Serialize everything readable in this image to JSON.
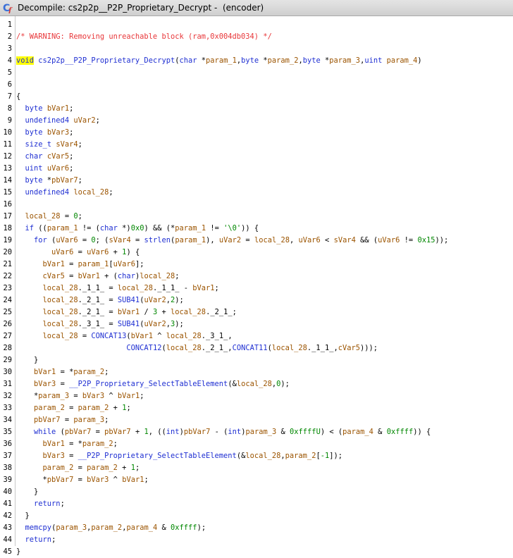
{
  "window": {
    "title": "Decompile: cs2p2p__P2P_Proprietary_Decrypt -  (encoder)",
    "icon": "decompiler-cf-icon"
  },
  "colors": {
    "comment": "#e8373a",
    "type": "#1f2fd2",
    "function": "#1f2fd2",
    "variable": "#9b5400",
    "number": "#008700",
    "highlight": "#ffff00"
  },
  "code_lines": [
    {
      "n": "1",
      "tokens": []
    },
    {
      "n": "2",
      "tokens": [
        [
          "cm",
          "/* WARNING: Removing unreachable block (ram,0x004db034) */"
        ]
      ]
    },
    {
      "n": "3",
      "tokens": []
    },
    {
      "n": "4",
      "tokens": [
        [
          "hl",
          "void"
        ],
        [
          "pl",
          " "
        ],
        [
          "fn",
          "cs2p2p__P2P_Proprietary_Decrypt"
        ],
        [
          "pl",
          "("
        ],
        [
          "ty",
          "char"
        ],
        [
          "pl",
          " *"
        ],
        [
          "vr",
          "param_1"
        ],
        [
          "pl",
          ","
        ],
        [
          "ty",
          "byte"
        ],
        [
          "pl",
          " *"
        ],
        [
          "vr",
          "param_2"
        ],
        [
          "pl",
          ","
        ],
        [
          "ty",
          "byte"
        ],
        [
          "pl",
          " *"
        ],
        [
          "vr",
          "param_3"
        ],
        [
          "pl",
          ","
        ],
        [
          "ty",
          "uint"
        ],
        [
          "pl",
          " "
        ],
        [
          "vr",
          "param_4"
        ],
        [
          "pl",
          ")"
        ]
      ]
    },
    {
      "n": "5",
      "tokens": []
    },
    {
      "n": "6",
      "tokens": []
    },
    {
      "n": "7",
      "tokens": [
        [
          "pl",
          "{"
        ]
      ]
    },
    {
      "n": "8",
      "tokens": [
        [
          "pl",
          "  "
        ],
        [
          "ty",
          "byte"
        ],
        [
          "pl",
          " "
        ],
        [
          "vr",
          "bVar1"
        ],
        [
          "pl",
          ";"
        ]
      ]
    },
    {
      "n": "9",
      "tokens": [
        [
          "pl",
          "  "
        ],
        [
          "ty",
          "undefined4"
        ],
        [
          "pl",
          " "
        ],
        [
          "vr",
          "uVar2"
        ],
        [
          "pl",
          ";"
        ]
      ]
    },
    {
      "n": "10",
      "tokens": [
        [
          "pl",
          "  "
        ],
        [
          "ty",
          "byte"
        ],
        [
          "pl",
          " "
        ],
        [
          "vr",
          "bVar3"
        ],
        [
          "pl",
          ";"
        ]
      ]
    },
    {
      "n": "11",
      "tokens": [
        [
          "pl",
          "  "
        ],
        [
          "ty",
          "size_t"
        ],
        [
          "pl",
          " "
        ],
        [
          "vr",
          "sVar4"
        ],
        [
          "pl",
          ";"
        ]
      ]
    },
    {
      "n": "12",
      "tokens": [
        [
          "pl",
          "  "
        ],
        [
          "ty",
          "char"
        ],
        [
          "pl",
          " "
        ],
        [
          "vr",
          "cVar5"
        ],
        [
          "pl",
          ";"
        ]
      ]
    },
    {
      "n": "13",
      "tokens": [
        [
          "pl",
          "  "
        ],
        [
          "ty",
          "uint"
        ],
        [
          "pl",
          " "
        ],
        [
          "vr",
          "uVar6"
        ],
        [
          "pl",
          ";"
        ]
      ]
    },
    {
      "n": "14",
      "tokens": [
        [
          "pl",
          "  "
        ],
        [
          "ty",
          "byte"
        ],
        [
          "pl",
          " *"
        ],
        [
          "vr",
          "pbVar7"
        ],
        [
          "pl",
          ";"
        ]
      ]
    },
    {
      "n": "15",
      "tokens": [
        [
          "pl",
          "  "
        ],
        [
          "ty",
          "undefined4"
        ],
        [
          "pl",
          " "
        ],
        [
          "vr",
          "local_28"
        ],
        [
          "pl",
          ";"
        ]
      ]
    },
    {
      "n": "16",
      "tokens": []
    },
    {
      "n": "17",
      "tokens": [
        [
          "pl",
          "  "
        ],
        [
          "vr",
          "local_28"
        ],
        [
          "pl",
          " = "
        ],
        [
          "nm",
          "0"
        ],
        [
          "pl",
          ";"
        ]
      ]
    },
    {
      "n": "18",
      "tokens": [
        [
          "pl",
          "  "
        ],
        [
          "kw",
          "if"
        ],
        [
          "pl",
          " (("
        ],
        [
          "vr",
          "param_1"
        ],
        [
          "pl",
          " != ("
        ],
        [
          "ty",
          "char"
        ],
        [
          "pl",
          " *)"
        ],
        [
          "nm",
          "0x0"
        ],
        [
          "pl",
          ") && (*"
        ],
        [
          "vr",
          "param_1"
        ],
        [
          "pl",
          " != "
        ],
        [
          "nm",
          "'\\0'"
        ],
        [
          "pl",
          ")) {"
        ]
      ]
    },
    {
      "n": "19",
      "tokens": [
        [
          "pl",
          "    "
        ],
        [
          "kw",
          "for"
        ],
        [
          "pl",
          " ("
        ],
        [
          "vr",
          "uVar6"
        ],
        [
          "pl",
          " = "
        ],
        [
          "nm",
          "0"
        ],
        [
          "pl",
          "; ("
        ],
        [
          "vr",
          "sVar4"
        ],
        [
          "pl",
          " = "
        ],
        [
          "fn",
          "strlen"
        ],
        [
          "pl",
          "("
        ],
        [
          "vr",
          "param_1"
        ],
        [
          "pl",
          "), "
        ],
        [
          "vr",
          "uVar2"
        ],
        [
          "pl",
          " = "
        ],
        [
          "vr",
          "local_28"
        ],
        [
          "pl",
          ", "
        ],
        [
          "vr",
          "uVar6"
        ],
        [
          "pl",
          " < "
        ],
        [
          "vr",
          "sVar4"
        ],
        [
          "pl",
          " && ("
        ],
        [
          "vr",
          "uVar6"
        ],
        [
          "pl",
          " != "
        ],
        [
          "nm",
          "0x15"
        ],
        [
          "pl",
          "));"
        ]
      ]
    },
    {
      "n": "20",
      "tokens": [
        [
          "pl",
          "        "
        ],
        [
          "vr",
          "uVar6"
        ],
        [
          "pl",
          " = "
        ],
        [
          "vr",
          "uVar6"
        ],
        [
          "pl",
          " + "
        ],
        [
          "nm",
          "1"
        ],
        [
          "pl",
          ") {"
        ]
      ]
    },
    {
      "n": "21",
      "tokens": [
        [
          "pl",
          "      "
        ],
        [
          "vr",
          "bVar1"
        ],
        [
          "pl",
          " = "
        ],
        [
          "vr",
          "param_1"
        ],
        [
          "pl",
          "["
        ],
        [
          "vr",
          "uVar6"
        ],
        [
          "pl",
          "];"
        ]
      ]
    },
    {
      "n": "22",
      "tokens": [
        [
          "pl",
          "      "
        ],
        [
          "vr",
          "cVar5"
        ],
        [
          "pl",
          " = "
        ],
        [
          "vr",
          "bVar1"
        ],
        [
          "pl",
          " + ("
        ],
        [
          "ty",
          "char"
        ],
        [
          "pl",
          ")"
        ],
        [
          "vr",
          "local_28"
        ],
        [
          "pl",
          ";"
        ]
      ]
    },
    {
      "n": "23",
      "tokens": [
        [
          "pl",
          "      "
        ],
        [
          "vr",
          "local_28"
        ],
        [
          "pl",
          "._1_1_ = "
        ],
        [
          "vr",
          "local_28"
        ],
        [
          "pl",
          "._1_1_ - "
        ],
        [
          "vr",
          "bVar1"
        ],
        [
          "pl",
          ";"
        ]
      ]
    },
    {
      "n": "24",
      "tokens": [
        [
          "pl",
          "      "
        ],
        [
          "vr",
          "local_28"
        ],
        [
          "pl",
          "._2_1_ = "
        ],
        [
          "fn",
          "SUB41"
        ],
        [
          "pl",
          "("
        ],
        [
          "vr",
          "uVar2"
        ],
        [
          "pl",
          ","
        ],
        [
          "nm",
          "2"
        ],
        [
          "pl",
          ");"
        ]
      ]
    },
    {
      "n": "25",
      "tokens": [
        [
          "pl",
          "      "
        ],
        [
          "vr",
          "local_28"
        ],
        [
          "pl",
          "._2_1_ = "
        ],
        [
          "vr",
          "bVar1"
        ],
        [
          "pl",
          " / "
        ],
        [
          "nm",
          "3"
        ],
        [
          "pl",
          " + "
        ],
        [
          "vr",
          "local_28"
        ],
        [
          "pl",
          "._2_1_;"
        ]
      ]
    },
    {
      "n": "26",
      "tokens": [
        [
          "pl",
          "      "
        ],
        [
          "vr",
          "local_28"
        ],
        [
          "pl",
          "._3_1_ = "
        ],
        [
          "fn",
          "SUB41"
        ],
        [
          "pl",
          "("
        ],
        [
          "vr",
          "uVar2"
        ],
        [
          "pl",
          ","
        ],
        [
          "nm",
          "3"
        ],
        [
          "pl",
          ");"
        ]
      ]
    },
    {
      "n": "27",
      "tokens": [
        [
          "pl",
          "      "
        ],
        [
          "vr",
          "local_28"
        ],
        [
          "pl",
          " = "
        ],
        [
          "fn",
          "CONCAT13"
        ],
        [
          "pl",
          "("
        ],
        [
          "vr",
          "bVar1"
        ],
        [
          "pl",
          " ^ "
        ],
        [
          "vr",
          "local_28"
        ],
        [
          "pl",
          "._3_1_,"
        ]
      ]
    },
    {
      "n": "28",
      "tokens": [
        [
          "pl",
          "                         "
        ],
        [
          "fn",
          "CONCAT12"
        ],
        [
          "pl",
          "("
        ],
        [
          "vr",
          "local_28"
        ],
        [
          "pl",
          "._2_1_,"
        ],
        [
          "fn",
          "CONCAT11"
        ],
        [
          "pl",
          "("
        ],
        [
          "vr",
          "local_28"
        ],
        [
          "pl",
          "._1_1_,"
        ],
        [
          "vr",
          "cVar5"
        ],
        [
          "pl",
          ")));"
        ]
      ]
    },
    {
      "n": "29",
      "tokens": [
        [
          "pl",
          "    }"
        ]
      ]
    },
    {
      "n": "30",
      "tokens": [
        [
          "pl",
          "    "
        ],
        [
          "vr",
          "bVar1"
        ],
        [
          "pl",
          " = *"
        ],
        [
          "vr",
          "param_2"
        ],
        [
          "pl",
          ";"
        ]
      ]
    },
    {
      "n": "31",
      "tokens": [
        [
          "pl",
          "    "
        ],
        [
          "vr",
          "bVar3"
        ],
        [
          "pl",
          " = "
        ],
        [
          "fn",
          "__P2P_Proprietary_SelectTableElement"
        ],
        [
          "pl",
          "(&"
        ],
        [
          "vr",
          "local_28"
        ],
        [
          "pl",
          ","
        ],
        [
          "nm",
          "0"
        ],
        [
          "pl",
          ");"
        ]
      ]
    },
    {
      "n": "32",
      "tokens": [
        [
          "pl",
          "    *"
        ],
        [
          "vr",
          "param_3"
        ],
        [
          "pl",
          " = "
        ],
        [
          "vr",
          "bVar3"
        ],
        [
          "pl",
          " ^ "
        ],
        [
          "vr",
          "bVar1"
        ],
        [
          "pl",
          ";"
        ]
      ]
    },
    {
      "n": "33",
      "tokens": [
        [
          "pl",
          "    "
        ],
        [
          "vr",
          "param_2"
        ],
        [
          "pl",
          " = "
        ],
        [
          "vr",
          "param_2"
        ],
        [
          "pl",
          " + "
        ],
        [
          "nm",
          "1"
        ],
        [
          "pl",
          ";"
        ]
      ]
    },
    {
      "n": "34",
      "tokens": [
        [
          "pl",
          "    "
        ],
        [
          "vr",
          "pbVar7"
        ],
        [
          "pl",
          " = "
        ],
        [
          "vr",
          "param_3"
        ],
        [
          "pl",
          ";"
        ]
      ]
    },
    {
      "n": "35",
      "tokens": [
        [
          "pl",
          "    "
        ],
        [
          "kw",
          "while"
        ],
        [
          "pl",
          " ("
        ],
        [
          "vr",
          "pbVar7"
        ],
        [
          "pl",
          " = "
        ],
        [
          "vr",
          "pbVar7"
        ],
        [
          "pl",
          " + "
        ],
        [
          "nm",
          "1"
        ],
        [
          "pl",
          ", (("
        ],
        [
          "ty",
          "int"
        ],
        [
          "pl",
          ")"
        ],
        [
          "vr",
          "pbVar7"
        ],
        [
          "pl",
          " - ("
        ],
        [
          "ty",
          "int"
        ],
        [
          "pl",
          ")"
        ],
        [
          "vr",
          "param_3"
        ],
        [
          "pl",
          " & "
        ],
        [
          "nm",
          "0xffffU"
        ],
        [
          "pl",
          ") < ("
        ],
        [
          "vr",
          "param_4"
        ],
        [
          "pl",
          " & "
        ],
        [
          "nm",
          "0xffff"
        ],
        [
          "pl",
          ")) {"
        ]
      ]
    },
    {
      "n": "36",
      "tokens": [
        [
          "pl",
          "      "
        ],
        [
          "vr",
          "bVar1"
        ],
        [
          "pl",
          " = *"
        ],
        [
          "vr",
          "param_2"
        ],
        [
          "pl",
          ";"
        ]
      ]
    },
    {
      "n": "37",
      "tokens": [
        [
          "pl",
          "      "
        ],
        [
          "vr",
          "bVar3"
        ],
        [
          "pl",
          " = "
        ],
        [
          "fn",
          "__P2P_Proprietary_SelectTableElement"
        ],
        [
          "pl",
          "(&"
        ],
        [
          "vr",
          "local_28"
        ],
        [
          "pl",
          ","
        ],
        [
          "vr",
          "param_2"
        ],
        [
          "pl",
          "["
        ],
        [
          "nm",
          "-1"
        ],
        [
          "pl",
          "]);"
        ]
      ]
    },
    {
      "n": "38",
      "tokens": [
        [
          "pl",
          "      "
        ],
        [
          "vr",
          "param_2"
        ],
        [
          "pl",
          " = "
        ],
        [
          "vr",
          "param_2"
        ],
        [
          "pl",
          " + "
        ],
        [
          "nm",
          "1"
        ],
        [
          "pl",
          ";"
        ]
      ]
    },
    {
      "n": "39",
      "tokens": [
        [
          "pl",
          "      *"
        ],
        [
          "vr",
          "pbVar7"
        ],
        [
          "pl",
          " = "
        ],
        [
          "vr",
          "bVar3"
        ],
        [
          "pl",
          " ^ "
        ],
        [
          "vr",
          "bVar1"
        ],
        [
          "pl",
          ";"
        ]
      ]
    },
    {
      "n": "40",
      "tokens": [
        [
          "pl",
          "    }"
        ]
      ]
    },
    {
      "n": "41",
      "tokens": [
        [
          "pl",
          "    "
        ],
        [
          "kw",
          "return"
        ],
        [
          "pl",
          ";"
        ]
      ]
    },
    {
      "n": "42",
      "tokens": [
        [
          "pl",
          "  }"
        ]
      ]
    },
    {
      "n": "43",
      "tokens": [
        [
          "pl",
          "  "
        ],
        [
          "fn",
          "memcpy"
        ],
        [
          "pl",
          "("
        ],
        [
          "vr",
          "param_3"
        ],
        [
          "pl",
          ","
        ],
        [
          "vr",
          "param_2"
        ],
        [
          "pl",
          ","
        ],
        [
          "vr",
          "param_4"
        ],
        [
          "pl",
          " & "
        ],
        [
          "nm",
          "0xffff"
        ],
        [
          "pl",
          ");"
        ]
      ]
    },
    {
      "n": "44",
      "tokens": [
        [
          "pl",
          "  "
        ],
        [
          "kw",
          "return"
        ],
        [
          "pl",
          ";"
        ]
      ]
    },
    {
      "n": "45",
      "tokens": [
        [
          "pl",
          "}"
        ]
      ]
    }
  ]
}
